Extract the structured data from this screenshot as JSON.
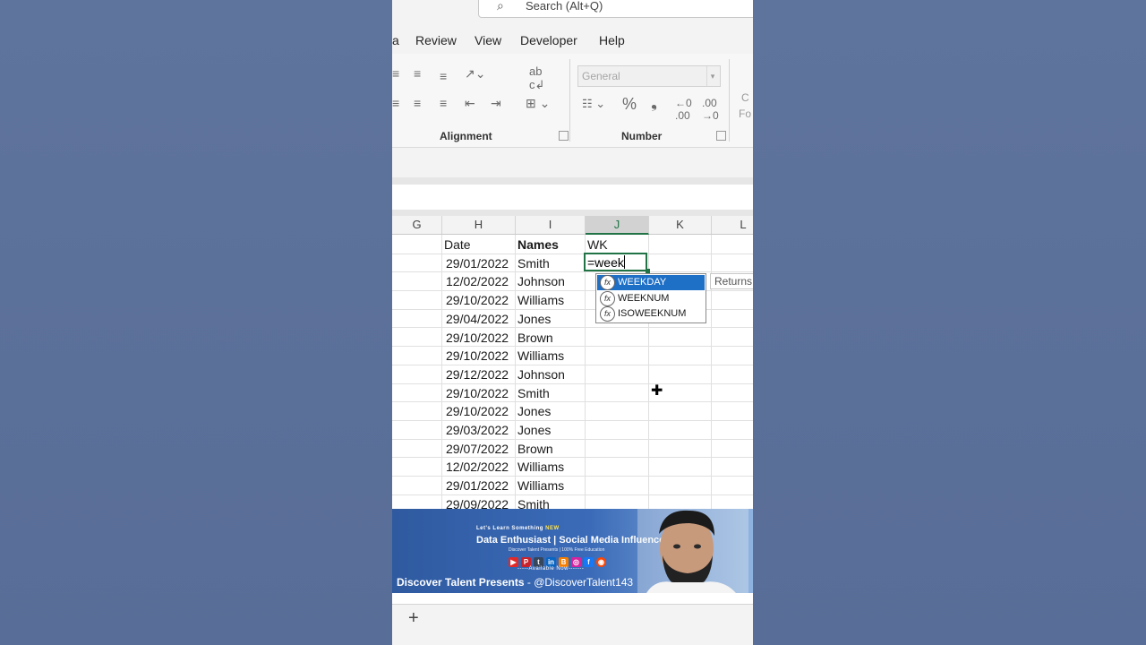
{
  "search": {
    "placeholder": "Search (Alt+Q)"
  },
  "menu": {
    "items": [
      "a",
      "Review",
      "View",
      "Developer",
      "Help"
    ]
  },
  "ribbon": {
    "alignment_label": "Alignment",
    "number_label": "Number",
    "number_format_value": "General",
    "percent_symbol": "%",
    "comma_symbol": "❟",
    "cut_off_text_top": "C",
    "cut_off_text_bottom": "Fo"
  },
  "columns": [
    "G",
    "H",
    "I",
    "J",
    "K",
    "L"
  ],
  "selected_column": "J",
  "sheet": {
    "headers": {
      "date": "Date",
      "names": "Names",
      "wk": "WK"
    },
    "rows": [
      {
        "date": "29/01/2022",
        "name": "Smith"
      },
      {
        "date": "12/02/2022",
        "name": "Johnson"
      },
      {
        "date": "29/10/2022",
        "name": "Williams"
      },
      {
        "date": "29/04/2022",
        "name": "Jones"
      },
      {
        "date": "29/10/2022",
        "name": "Brown"
      },
      {
        "date": "29/10/2022",
        "name": "Williams"
      },
      {
        "date": "29/12/2022",
        "name": "Johnson"
      },
      {
        "date": "29/10/2022",
        "name": "Smith"
      },
      {
        "date": "29/10/2022",
        "name": "Jones"
      },
      {
        "date": "29/03/2022",
        "name": "Jones"
      },
      {
        "date": "29/07/2022",
        "name": "Brown"
      },
      {
        "date": "12/02/2022",
        "name": "Williams"
      },
      {
        "date": "29/01/2022",
        "name": "Williams"
      },
      {
        "date": "29/09/2022",
        "name": "Smith"
      }
    ],
    "active_cell_value": "=week"
  },
  "autocomplete": {
    "items": [
      "WEEKDAY",
      "WEEKNUM",
      "ISOWEEKNUM"
    ],
    "selected_index": 0,
    "tooltip": "Returns"
  },
  "banner": {
    "tagline_prefix": "Let's Learn Something",
    "tagline_new": "NEW",
    "headline": "Data Enthusiast | Social Media Influencer",
    "subline": "Discover Talent Presents | 100% Free Education",
    "available": "-----Available Now-------",
    "presents": "Discover Talent Presents",
    "handle": "- @DiscoverTalent143",
    "social_icons": [
      "youtube-icon",
      "pinterest-icon",
      "tumblr-icon",
      "linkedin-icon",
      "blogger-icon",
      "instagram-icon",
      "facebook-icon",
      "reddit-icon"
    ]
  },
  "bottom": {
    "add_sheet": "+"
  },
  "colors": {
    "accent_green": "#217346",
    "selection_blue": "#1e6fc6"
  }
}
